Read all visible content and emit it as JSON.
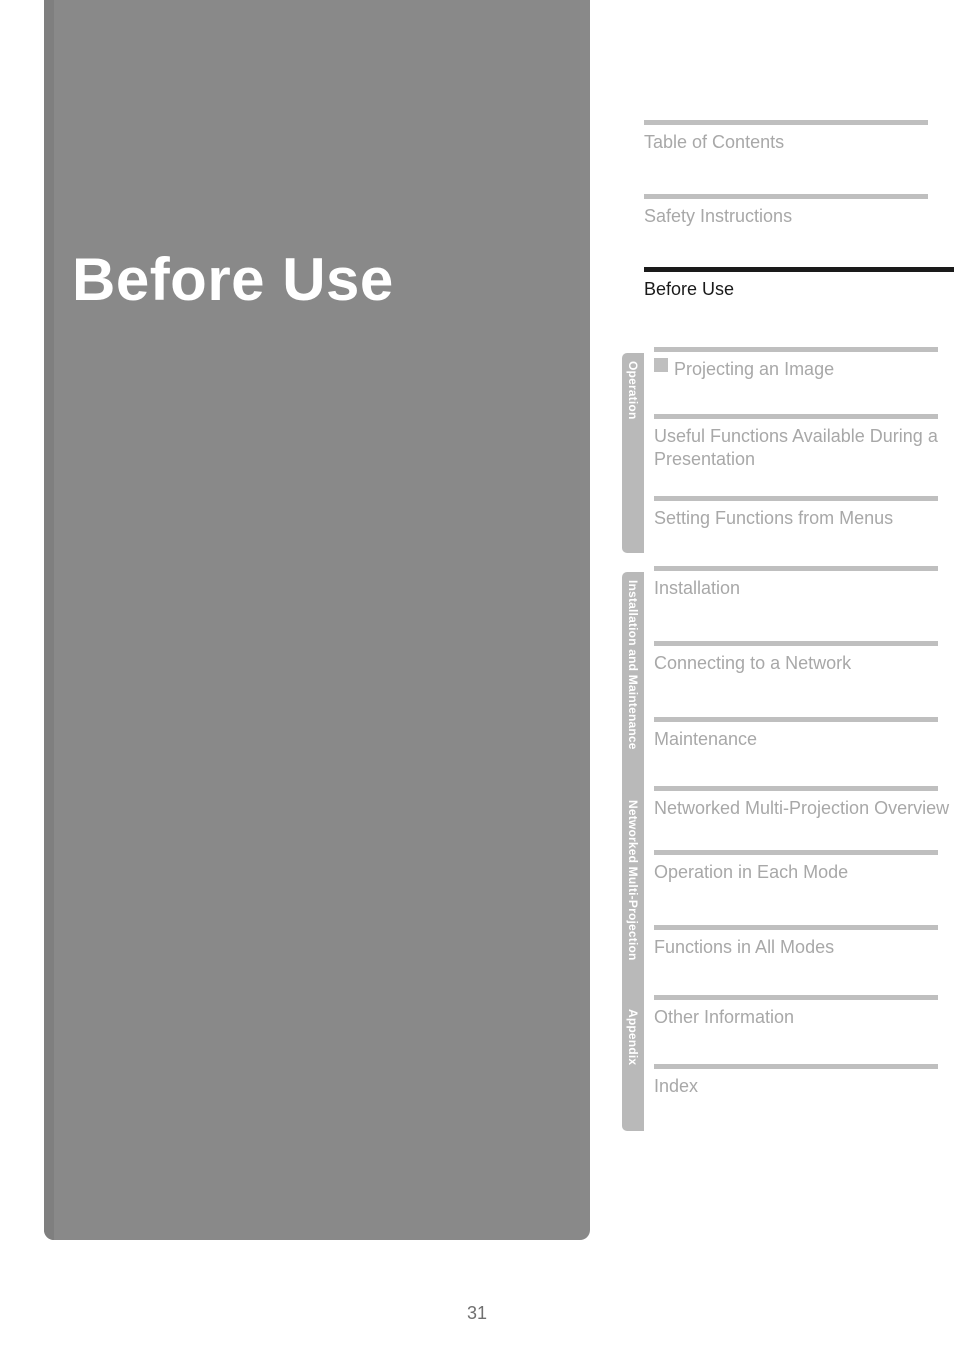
{
  "main_title": "Before Use",
  "page_number": "31",
  "nav": {
    "top0": {
      "label": "Table of Contents"
    },
    "top1": {
      "label": "Safety Instructions"
    },
    "active": {
      "label": "Before Use"
    }
  },
  "sections": [
    {
      "tab": "Operation",
      "items": [
        {
          "label": "Projecting an Image"
        },
        {
          "label": "Useful Functions Available During a Presentation"
        },
        {
          "label": "Setting Functions from Menus"
        }
      ]
    },
    {
      "tab": "Installation and Maintenance",
      "items": [
        {
          "label": "Installation"
        },
        {
          "label": "Connecting to a Network"
        },
        {
          "label": "Maintenance"
        }
      ]
    },
    {
      "tab": "Networked Multi-Projection",
      "items": [
        {
          "label": "Networked Multi-Projection Overview"
        },
        {
          "label": "Operation in Each Mode"
        },
        {
          "label": "Functions in All Modes"
        }
      ]
    },
    {
      "tab": "Appendix",
      "items": [
        {
          "label": "Other Information"
        },
        {
          "label": "Index"
        }
      ]
    }
  ]
}
